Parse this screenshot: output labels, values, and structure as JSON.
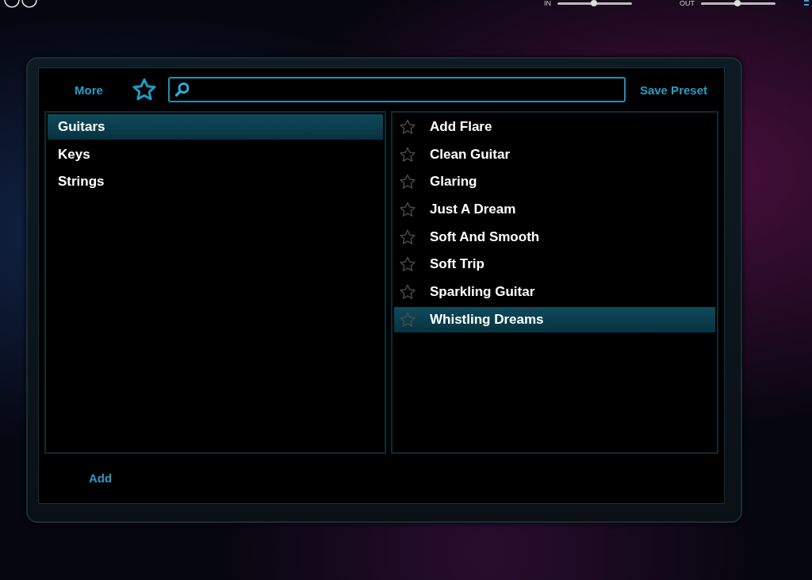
{
  "header": {
    "meters": [
      {
        "label": "IN",
        "level": 0.49
      },
      {
        "label": "OUT",
        "level": 0.49
      }
    ]
  },
  "toolbar": {
    "more": "More",
    "favorites_filter": {
      "on": false
    },
    "save": "Save Preset"
  },
  "categories": [
    {
      "label": "Guitars",
      "selected": true
    },
    {
      "label": "Keys",
      "selected": false
    },
    {
      "label": "Strings",
      "selected": false
    }
  ],
  "presets": [
    {
      "label": "Add Flare",
      "favorite": false,
      "selected": false
    },
    {
      "label": "Clean Guitar",
      "favorite": false,
      "selected": false
    },
    {
      "label": "Glaring",
      "favorite": false,
      "selected": false
    },
    {
      "label": "Just A Dream",
      "favorite": false,
      "selected": false
    },
    {
      "label": "Soft And Smooth",
      "favorite": false,
      "selected": false
    },
    {
      "label": "Soft Trip",
      "favorite": false,
      "selected": false
    },
    {
      "label": "Sparkling Guitar",
      "favorite": false,
      "selected": false
    },
    {
      "label": "Whistling Dreams",
      "favorite": false,
      "selected": true
    }
  ],
  "footer": {
    "add": "Add"
  }
}
